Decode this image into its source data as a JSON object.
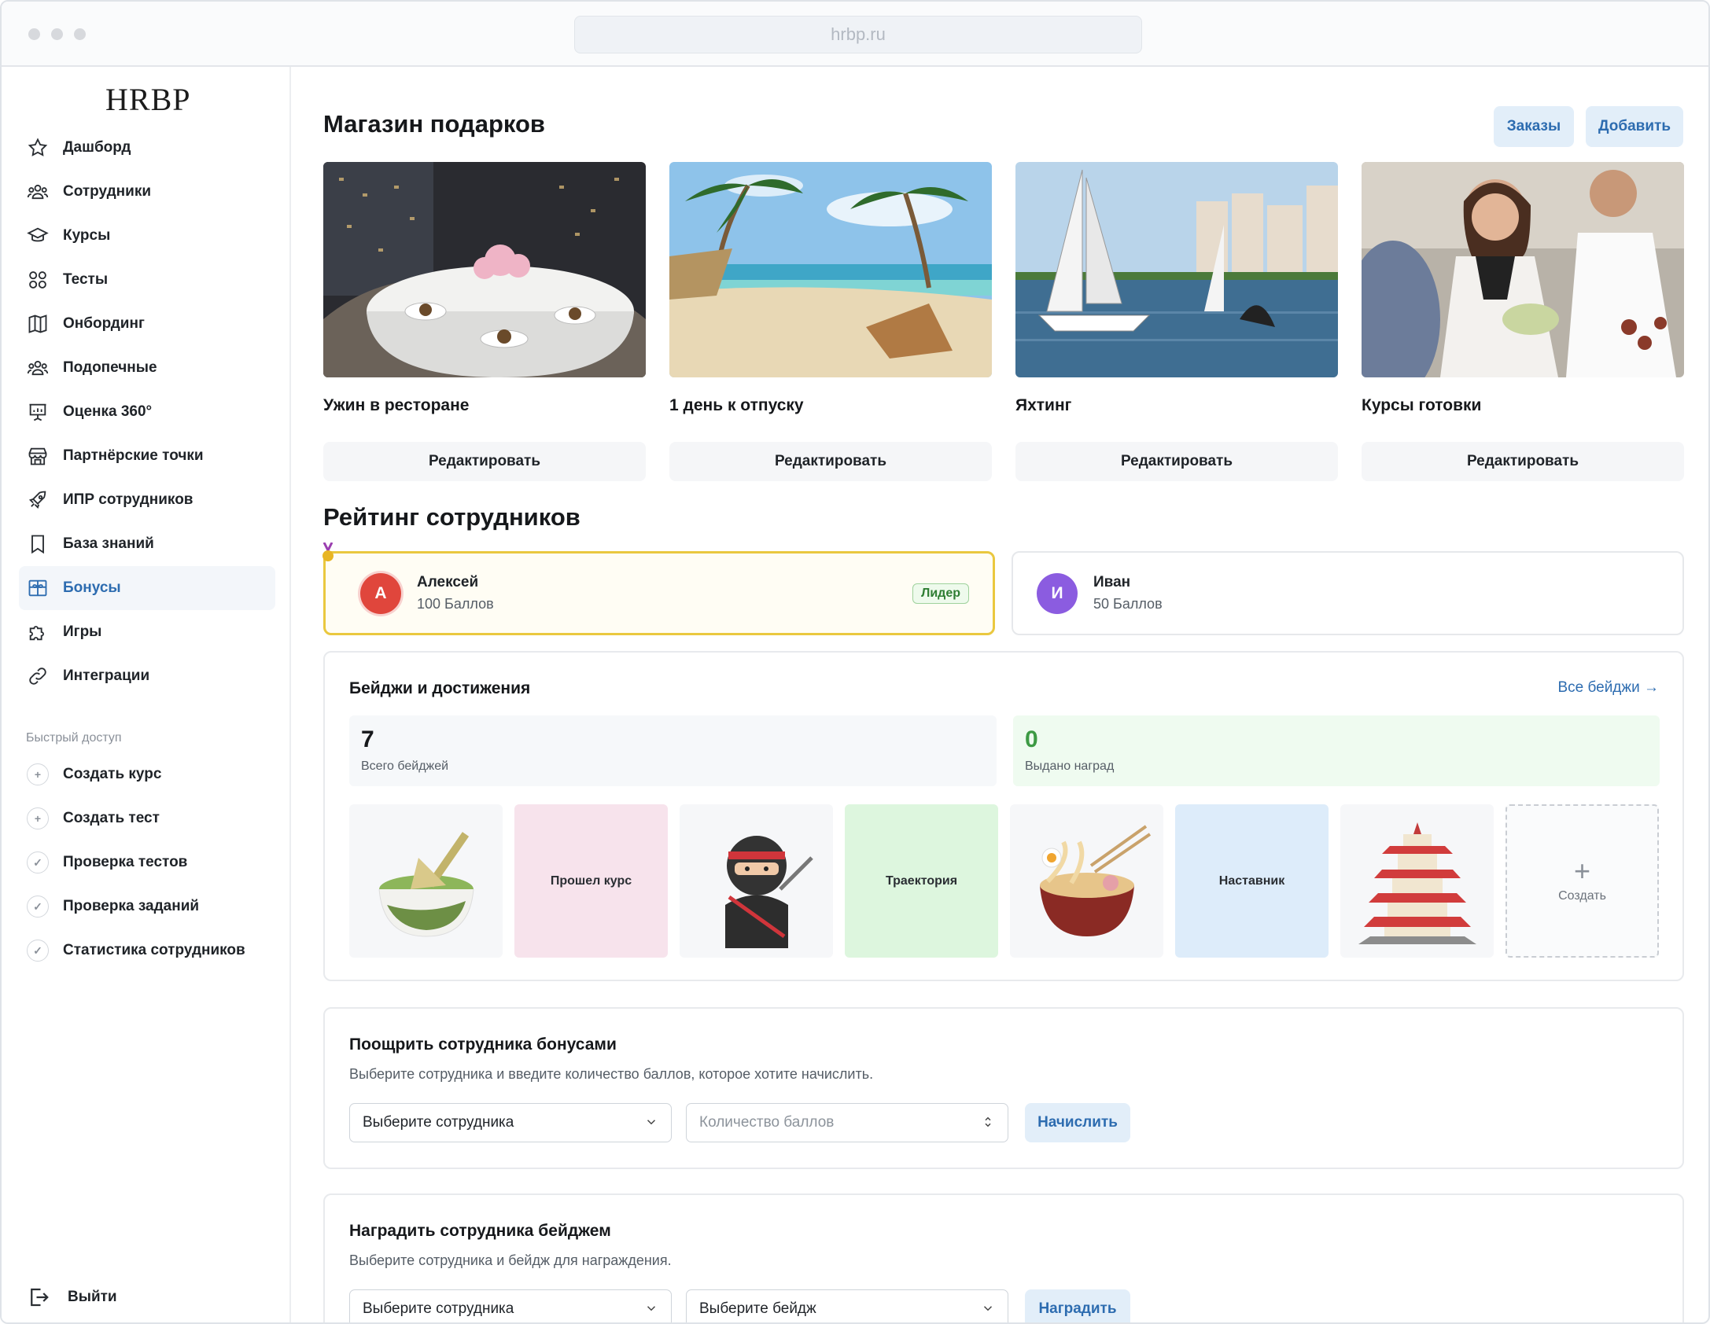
{
  "browser": {
    "url": "hrbp.ru"
  },
  "sidebar": {
    "logo": "HRBP",
    "items": [
      {
        "label": "Дашборд",
        "icon": "star-icon"
      },
      {
        "label": "Сотрудники",
        "icon": "users-icon"
      },
      {
        "label": "Курсы",
        "icon": "graduation-cap-icon"
      },
      {
        "label": "Тесты",
        "icon": "grid-icon"
      },
      {
        "label": "Онбординг",
        "icon": "map-icon"
      },
      {
        "label": "Подопечные",
        "icon": "users-icon"
      },
      {
        "label": "Оценка 360°",
        "icon": "presentation-icon"
      },
      {
        "label": "Партнёрские точки",
        "icon": "store-icon"
      },
      {
        "label": "ИПР сотрудников",
        "icon": "rocket-icon"
      },
      {
        "label": "База знаний",
        "icon": "bookmark-icon"
      },
      {
        "label": "Бонусы",
        "icon": "gift-icon",
        "active": true
      },
      {
        "label": "Игры",
        "icon": "puzzle-icon"
      },
      {
        "label": "Интеграции",
        "icon": "link-icon"
      }
    ],
    "quick_access_title": "Быстрый доступ",
    "quick_access": [
      {
        "label": "Создать курс",
        "icon": "plus-icon"
      },
      {
        "label": "Создать тест",
        "icon": "plus-icon"
      },
      {
        "label": "Проверка тестов",
        "icon": "check-icon"
      },
      {
        "label": "Проверка заданий",
        "icon": "check-icon"
      },
      {
        "label": "Статистика сотрудников",
        "icon": "check-icon"
      }
    ],
    "logout": "Выйти"
  },
  "shop": {
    "title": "Магазин подарков",
    "orders_button": "Заказы",
    "add_button": "Добавить",
    "gifts": [
      {
        "title": "Ужин в ресторане",
        "edit": "Редактировать"
      },
      {
        "title": "1 день к отпуску",
        "edit": "Редактировать"
      },
      {
        "title": "Яхтинг",
        "edit": "Редактировать"
      },
      {
        "title": "Курсы готовки",
        "edit": "Редактировать"
      }
    ]
  },
  "rating": {
    "title": "Рейтинг сотрудников",
    "employees": [
      {
        "initial": "А",
        "name": "Алексей",
        "points": "100 Баллов",
        "badge": "Лидер",
        "color": "#e0463c"
      },
      {
        "initial": "И",
        "name": "Иван",
        "points": "50 Баллов",
        "color": "#8b5ce0"
      }
    ]
  },
  "badges": {
    "title": "Бейджи и достижения",
    "all_link": "Все бейджи →",
    "total_value": "7",
    "total_label": "Всего бейджей",
    "awarded_value": "0",
    "awarded_label": "Выдано наград",
    "items": [
      {
        "type": "image",
        "icon": "matcha-bowl-icon"
      },
      {
        "type": "text",
        "label": "Прошел курс",
        "color": "#f7e3ec"
      },
      {
        "type": "image",
        "icon": "ninja-icon"
      },
      {
        "type": "text",
        "label": "Траектория",
        "color": "#ddf6de"
      },
      {
        "type": "image",
        "icon": "ramen-icon"
      },
      {
        "type": "text",
        "label": "Наставник",
        "color": "#ddecfa"
      },
      {
        "type": "image",
        "icon": "pagoda-icon"
      }
    ],
    "create_label": "Создать",
    "create_symbol": "+"
  },
  "reward_points": {
    "title": "Поощрить сотрудника бонусами",
    "subtitle": "Выберите сотрудника и введите количество баллов, которое хотите начислить.",
    "employee_select": "Выберите сотрудника",
    "points_placeholder": "Количество баллов",
    "submit": "Начислить"
  },
  "reward_badge": {
    "title": "Наградить сотрудника бейджем",
    "subtitle": "Выберите сотрудника и бейдж для награждения.",
    "employee_select": "Выберите сотрудника",
    "badge_select": "Выберите бейдж",
    "submit": "Наградить"
  }
}
